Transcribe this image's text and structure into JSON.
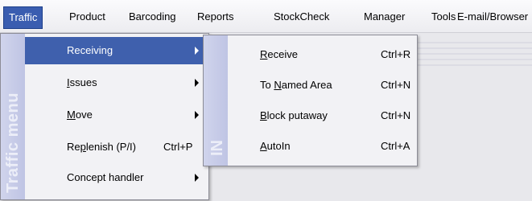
{
  "menubar": {
    "items": [
      {
        "label": "Traffic",
        "active": true
      },
      {
        "label": "Product"
      },
      {
        "label": "Barcoding"
      },
      {
        "label": "Reports"
      },
      {
        "label": "StockCheck"
      },
      {
        "label": "Manager"
      },
      {
        "label": "Tools"
      },
      {
        "label": "E-mail/Browser"
      }
    ]
  },
  "traffic_menu": {
    "sidebar_title": "Traffic menu",
    "items": [
      {
        "label": "Receiving",
        "highlighted": true,
        "has_submenu": true
      },
      {
        "label_pre": "",
        "mnemonic": "I",
        "label_post": "ssues",
        "has_submenu": true
      },
      {
        "label_pre": "",
        "mnemonic": "M",
        "label_post": "ove",
        "has_submenu": true
      },
      {
        "label_pre": "Re",
        "mnemonic": "p",
        "label_post": "lenish (P/I)",
        "shortcut": "Ctrl+P"
      },
      {
        "label": "Concept handler",
        "has_submenu": true
      }
    ]
  },
  "receiving_menu": {
    "sidebar_title": "IN",
    "items": [
      {
        "label_pre": "",
        "mnemonic": "R",
        "label_post": "eceive",
        "shortcut": "Ctrl+R"
      },
      {
        "label_pre": "To ",
        "mnemonic": "N",
        "label_post": "amed Area",
        "shortcut": "Ctrl+N"
      },
      {
        "label_pre": "",
        "mnemonic": "B",
        "label_post": "lock putaway",
        "shortcut": "Ctrl+N"
      },
      {
        "label_pre": "",
        "mnemonic": "A",
        "label_post": "utoIn",
        "shortcut": "Ctrl+A"
      }
    ]
  },
  "colors": {
    "highlight": "#3f60ad",
    "sidebar": "#c8cce8",
    "menu_bg": "#f2f2f5"
  }
}
